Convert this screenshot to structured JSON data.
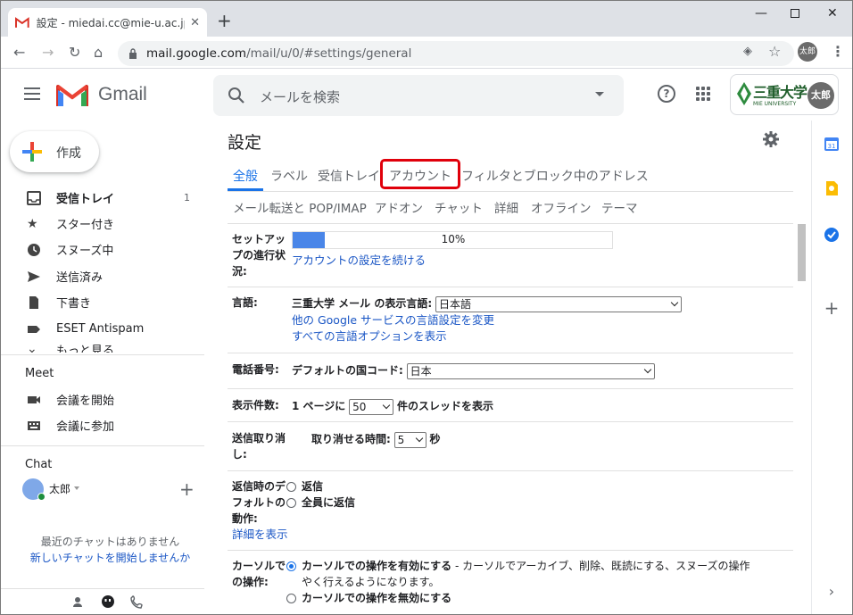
{
  "browser": {
    "tab_title": "設定 - miedai.cc@mie-u.ac.jp - 三",
    "url_host": "mail.google.com",
    "url_path": "/mail/u/0/#settings/general",
    "profile_initials": "太郎"
  },
  "header": {
    "app_name": "Gmail",
    "search_placeholder": "メールを検索",
    "org_name": "三重大学",
    "org_sub": "MIE UNIVERSITY",
    "user_initials": "太郎"
  },
  "nav": {
    "compose_label": "作成",
    "items": [
      {
        "label": "受信トレイ",
        "count": "1"
      },
      {
        "label": "スター付き"
      },
      {
        "label": "スヌーズ中"
      },
      {
        "label": "送信済み"
      },
      {
        "label": "下書き"
      },
      {
        "label": "ESET Antispam"
      },
      {
        "label": "もっと見る"
      }
    ],
    "meet_title": "Meet",
    "meet_items": [
      "会議を開始",
      "会議に参加"
    ],
    "chat_title": "Chat",
    "chat_user": "太郎",
    "no_chats": "最近のチャットはありません",
    "start_chat": "新しいチャットを開始しませんか"
  },
  "settings": {
    "title": "設定",
    "tabs_row1": [
      "全般",
      "ラベル",
      "受信トレイ",
      "アカウント",
      "フィルタとブロック中のアドレス"
    ],
    "tabs_row2": [
      "メール転送と POP/IMAP",
      "アドオン",
      "チャット",
      "詳細",
      "オフライン",
      "テーマ"
    ],
    "setup_label_1": "セットアッ",
    "setup_label_2": "プの進行状",
    "setup_label_3": "況:",
    "setup_progress_text": "10%",
    "setup_progress": 0.1,
    "setup_link": "アカウントの設定を続ける",
    "lang_label": "言語:",
    "lang_prefix": "三重大学 メール の表示言語:",
    "lang_value": "日本語",
    "lang_link1": "他の Google サービスの言語設定を変更",
    "lang_link2": "すべての言語オプションを表示",
    "phone_label": "電話番号:",
    "phone_prefix": "デフォルトの国コード:",
    "phone_value": "日本",
    "page_label": "表示件数:",
    "page_prefix": "1 ページに",
    "page_value": "50",
    "page_suffix": "件のスレッドを表示",
    "undo_label_1": "送信取り消",
    "undo_label_2": "し:",
    "undo_prefix": "取り消せる時間:",
    "undo_value": "5",
    "undo_suffix": "秒",
    "reply_label_1": "返信時のデ",
    "reply_label_2": "フォルトの",
    "reply_label_3": "動作:",
    "reply_opt1": "返信",
    "reply_opt2": "全員に返信",
    "reply_more": "詳細を表示",
    "cursor_label_1": "カーソルで",
    "cursor_label_2": "の操作:",
    "cursor_opt1": "カーソルでの操作を有効にする",
    "cursor_opt1_desc": " - カーソルでアーカイブ、削除、既読にする、スヌーズの操作",
    "cursor_opt1_desc2": "やく行えるようになります。",
    "cursor_opt2": "カーソルでの操作を無効にする"
  }
}
